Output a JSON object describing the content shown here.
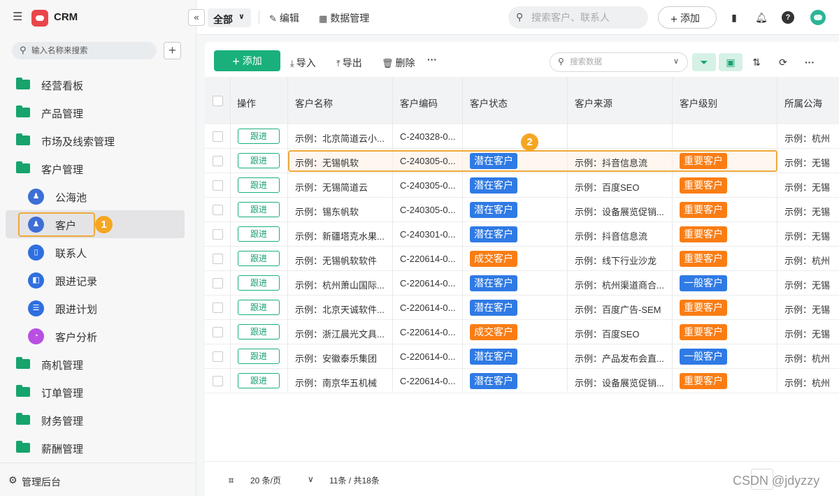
{
  "app": {
    "name": "CRM"
  },
  "sidebar": {
    "search_placeholder": "输入名称来搜索",
    "add_symbol": "+",
    "items": [
      "经营看板",
      "产品管理",
      "市场及线索管理",
      "客户管理"
    ],
    "sub_items": [
      {
        "label": "公海池",
        "icon": "public-pool-icon",
        "color": "#3d6fd6",
        "glyph": "♟"
      },
      {
        "label": "客户",
        "icon": "customer-icon",
        "color": "#3d6fd6",
        "glyph": "♟",
        "active": true
      },
      {
        "label": "联系人",
        "icon": "contact-icon",
        "color": "#2f6fe0",
        "glyph": "▯"
      },
      {
        "label": "跟进记录",
        "icon": "followup-record-icon",
        "color": "#2f6fe0",
        "glyph": "◧"
      },
      {
        "label": "跟进计划",
        "icon": "followup-plan-icon",
        "color": "#2f6fe0",
        "glyph": "☰"
      },
      {
        "label": "客户分析",
        "icon": "customer-analysis-icon",
        "color": "#b94fe2",
        "glyph": "◔"
      }
    ],
    "items_after": [
      "商机管理",
      "订单管理",
      "财务管理",
      "薪酬管理"
    ],
    "bottom_label": "管理后台",
    "marker_1": "1"
  },
  "header": {
    "scope": "全部",
    "edit": "编辑",
    "data_manage": "数据管理",
    "search_placeholder": "搜索客户、联系人",
    "add": "添加"
  },
  "toolbar": {
    "add": "添加",
    "import": "导入",
    "export": "导出",
    "delete": "删除",
    "more": "···",
    "search_placeholder": "搜索数据"
  },
  "table": {
    "columns": [
      "操作",
      "客户名称",
      "客户编码",
      "客户状态",
      "客户来源",
      "客户级别",
      "所属公海"
    ],
    "action_label": "跟进",
    "marker_2": "2",
    "rows": [
      {
        "name": "示例：北京简道云小...",
        "code": "C-240328-0...",
        "status": "",
        "source": "",
        "level": "",
        "pool": "示例：杭州"
      },
      {
        "name": "示例：无锡帆软",
        "code": "C-240305-0...",
        "status": "潜在客户",
        "source": "示例：抖音信息流",
        "level": "重要客户",
        "pool": "示例：无锡"
      },
      {
        "name": "示例：无锡简道云",
        "code": "C-240305-0...",
        "status": "潜在客户",
        "source": "示例：百度SEO",
        "level": "重要客户",
        "pool": "示例：无锡"
      },
      {
        "name": "示例：锡东帆软",
        "code": "C-240305-0...",
        "status": "潜在客户",
        "source": "示例：设备展览促销...",
        "level": "重要客户",
        "pool": "示例：无锡"
      },
      {
        "name": "示例：新疆塔克水果...",
        "code": "C-240301-0...",
        "status": "潜在客户",
        "source": "示例：抖音信息流",
        "level": "重要客户",
        "pool": "示例：无锡"
      },
      {
        "name": "示例：无锡帆软软件",
        "code": "C-220614-0...",
        "status": "成交客户",
        "source": "示例：线下行业沙龙",
        "level": "重要客户",
        "pool": "示例：杭州"
      },
      {
        "name": "示例：杭州萧山国际...",
        "code": "C-220614-0...",
        "status": "潜在客户",
        "source": "示例：杭州渠道商合...",
        "level": "一般客户",
        "pool": "示例：无锡"
      },
      {
        "name": "示例：北京天诚软件...",
        "code": "C-220614-0...",
        "status": "潜在客户",
        "source": "示例：百度广告-SEM",
        "level": "重要客户",
        "pool": "示例：无锡"
      },
      {
        "name": "示例：浙江晨光文具...",
        "code": "C-220614-0...",
        "status": "成交客户",
        "source": "示例：百度SEO",
        "level": "重要客户",
        "pool": "示例：无锡"
      },
      {
        "name": "示例：安徽泰乐集团",
        "code": "C-220614-0...",
        "status": "潜在客户",
        "source": "示例：产品发布会直...",
        "level": "一般客户",
        "pool": "示例：杭州"
      },
      {
        "name": "示例：南京华五机械",
        "code": "C-220614-0...",
        "status": "潜在客户",
        "source": "示例：设备展览促销...",
        "level": "重要客户",
        "pool": "示例：杭州"
      }
    ]
  },
  "colors": {
    "potential": "#2f7ae5",
    "deal": "#fa7d14",
    "important": "#fa7d14",
    "normal": "#2f7ae5",
    "accent": "#19b07b"
  },
  "footer": {
    "page_size": "20 条/页",
    "count": "11条 / 共18条",
    "icon_glyph": "ㅍ"
  },
  "watermark": "CSDN @jdyzzy"
}
